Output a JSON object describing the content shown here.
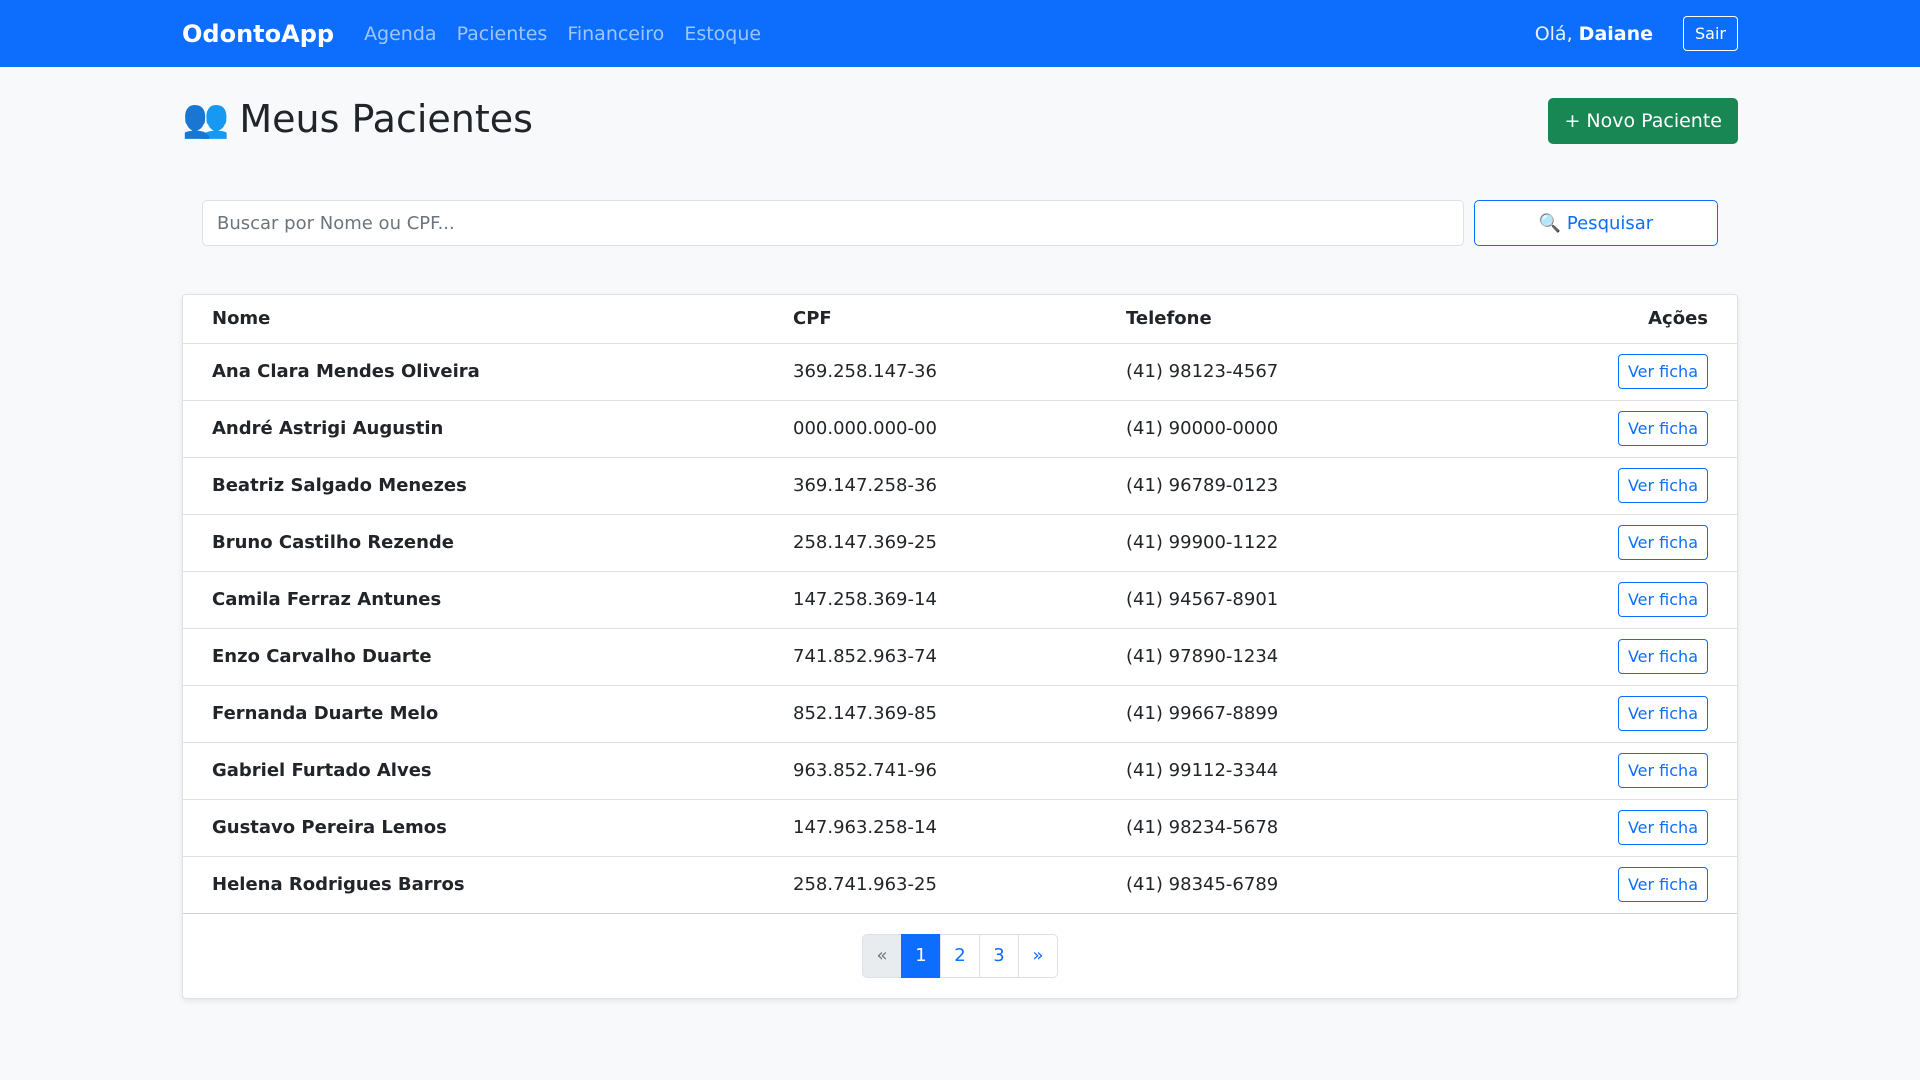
{
  "navbar": {
    "brand": "OdontoApp",
    "links": [
      "Agenda",
      "Pacientes",
      "Financeiro",
      "Estoque"
    ],
    "greeting_prefix": "Olá,",
    "user_name": "Daiane",
    "logout_label": "Sair"
  },
  "header": {
    "icon": "👥",
    "title": "Meus Pacientes",
    "new_button_label": "+ Novo Paciente"
  },
  "search": {
    "placeholder": "Buscar por Nome ou CPF...",
    "button_label": "🔍 Pesquisar"
  },
  "table": {
    "columns": [
      "Nome",
      "CPF",
      "Telefone",
      "Ações"
    ],
    "action_label": "Ver ficha",
    "rows": [
      {
        "name": "Ana Clara Mendes Oliveira",
        "cpf": "369.258.147-36",
        "phone": "(41) 98123-4567"
      },
      {
        "name": "André Astrigi Augustin",
        "cpf": "000.000.000-00",
        "phone": "(41) 90000-0000"
      },
      {
        "name": "Beatriz Salgado Menezes",
        "cpf": "369.147.258-36",
        "phone": "(41) 96789-0123"
      },
      {
        "name": "Bruno Castilho Rezende",
        "cpf": "258.147.369-25",
        "phone": "(41) 99900-1122"
      },
      {
        "name": "Camila Ferraz Antunes",
        "cpf": "147.258.369-14",
        "phone": "(41) 94567-8901"
      },
      {
        "name": "Enzo Carvalho Duarte",
        "cpf": "741.852.963-74",
        "phone": "(41) 97890-1234"
      },
      {
        "name": "Fernanda Duarte Melo",
        "cpf": "852.147.369-85",
        "phone": "(41) 99667-8899"
      },
      {
        "name": "Gabriel Furtado Alves",
        "cpf": "963.852.741-96",
        "phone": "(41) 99112-3344"
      },
      {
        "name": "Gustavo Pereira Lemos",
        "cpf": "147.963.258-14",
        "phone": "(41) 98234-5678"
      },
      {
        "name": "Helena Rodrigues Barros",
        "cpf": "258.741.963-25",
        "phone": "(41) 98345-6789"
      }
    ]
  },
  "pagination": {
    "prev": "«",
    "pages": [
      "1",
      "2",
      "3"
    ],
    "active_page": "1",
    "next": "»"
  },
  "colors": {
    "primary": "#0d6efd",
    "success": "#198754"
  }
}
